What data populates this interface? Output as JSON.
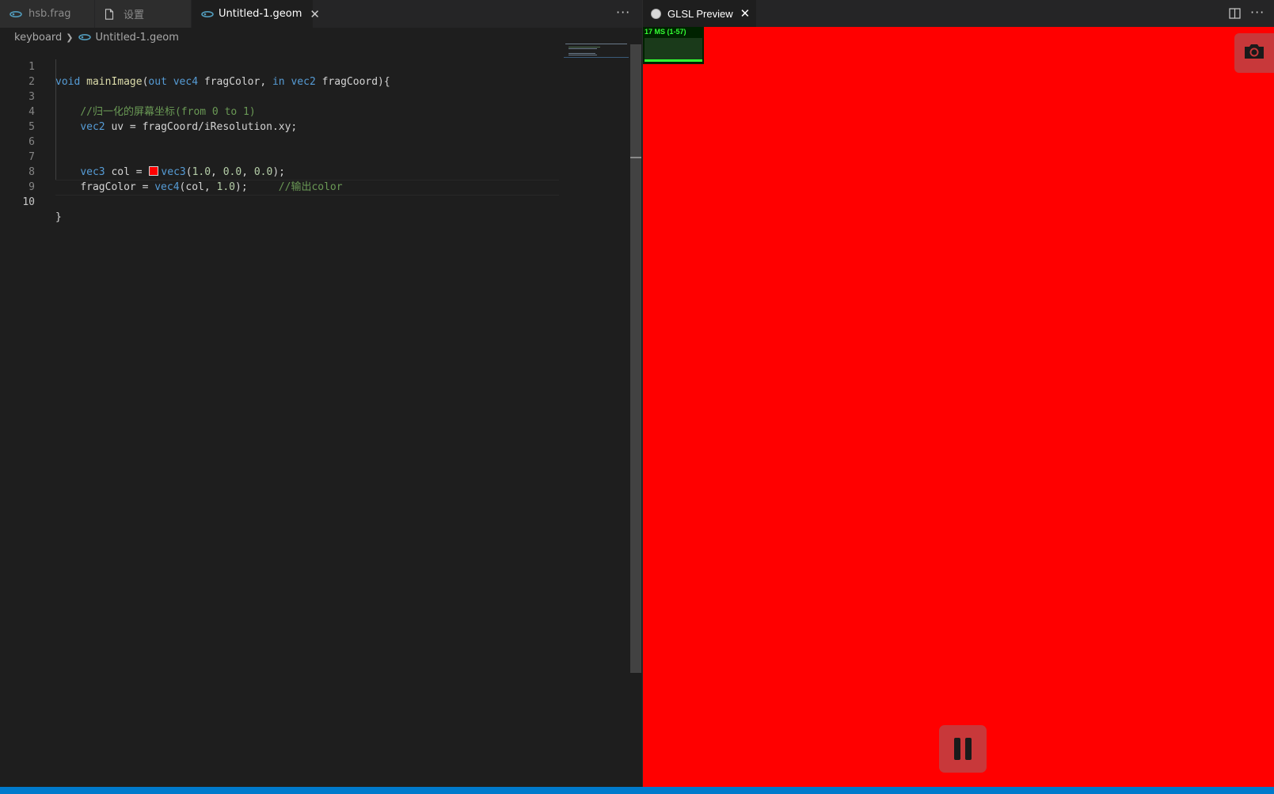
{
  "editor": {
    "tabs": [
      {
        "label": "hsb.frag",
        "icon": "glsl-file-icon",
        "active": false
      },
      {
        "label": "设置",
        "icon": "file-icon",
        "active": false
      },
      {
        "label": "Untitled-1.geom",
        "icon": "glsl-file-icon",
        "active": true
      }
    ],
    "more_actions": "···",
    "breadcrumb": {
      "folder": "keyboard",
      "file": "Untitled-1.geom"
    },
    "line_numbers": [
      "1",
      "2",
      "3",
      "4",
      "5",
      "6",
      "7",
      "8",
      "9",
      "10"
    ],
    "code": {
      "l1": {
        "kw_void": "void",
        "fn_main": "mainImage",
        "p1": "(",
        "kw_out": "out",
        "kw_vec4": "vec4",
        "arg1": "fragColor,",
        "kw_in": "in",
        "kw_vec2": "vec2",
        "arg2": "fragCoord){"
      },
      "l3": {
        "comment": "//归一化的屏幕坐标(from 0 to 1)"
      },
      "l4": {
        "kw_vec2": "vec2",
        "rest": "uv = fragCoord/iResolution.xy;"
      },
      "l7": {
        "kw_vec3": "vec3",
        "var": "col =",
        "ctor": "vec3",
        "open": "(",
        "n1": "1.0",
        "c1": ",",
        "n2": "0.0",
        "c2": ",",
        "n3": "0.0",
        "close": ");"
      },
      "l8": {
        "var": "fragColor =",
        "ctor": "vec4",
        "args": "(col,",
        "n1": "1.0",
        "close": ");",
        "comment": "//输出color"
      },
      "l10": {
        "brace": "}"
      }
    },
    "swatch_color": "#ff0000"
  },
  "preview": {
    "tab_label": "GLSL Preview",
    "more_actions": "···",
    "stats_text": "17 MS (1-57)",
    "background_color": "#ff0000",
    "button_color": "#c8383a"
  },
  "colors": {
    "accent": "#007acc",
    "keyword": "#569cd6",
    "number": "#b5cea8",
    "comment": "#6a9955",
    "function": "#dcdcaa"
  }
}
